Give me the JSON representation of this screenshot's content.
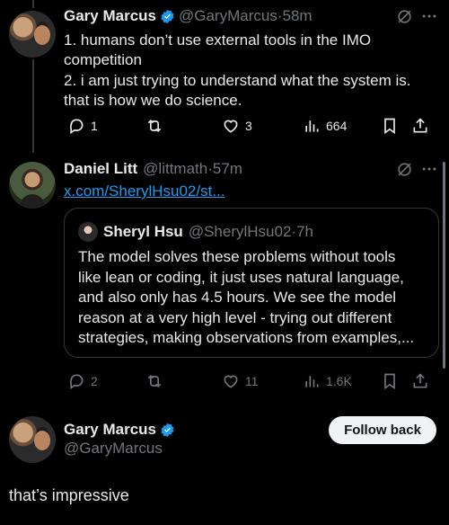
{
  "tweet1": {
    "name": "Gary Marcus",
    "handle": "@GaryMarcus",
    "time": "·58m",
    "line1": "1. humans don’t use external tools in the IMO",
    "line2": "competition",
    "line3": "2. i am just trying to understand what the system is.",
    "line4": "that is how we do science.",
    "replies": "1",
    "likes": "3",
    "views": "664"
  },
  "tweet2": {
    "name": "Daniel Litt",
    "handle": "@littmath",
    "time": "·57m",
    "link": "x.com/SherylHsu02/st...",
    "replies": "2",
    "likes": "11",
    "views": "1.6K"
  },
  "quote": {
    "name": "Sheryl Hsu",
    "handle": "@SherylHsu02",
    "time": "·7h",
    "line1": "The model solves these problems without tools",
    "line2": "like lean or coding, it just uses natural language,",
    "line3": "and also only has 4.5 hours. We see the model",
    "line4": "reason at a very high level - trying out different",
    "line5": "strategies, making observations from examples,..."
  },
  "profile": {
    "name": "Gary Marcus",
    "handle": "@GaryMarcus",
    "follow_label": "Follow back"
  },
  "reply_text": "that’s impressive",
  "icons": [
    "grok-icon",
    "more-icon",
    "reply-icon",
    "retweet-icon",
    "like-icon",
    "views-icon",
    "bookmark-icon",
    "share-icon",
    "verified-badge-icon"
  ],
  "colors": {
    "background": "#000000",
    "text": "#e7e9ea",
    "muted": "#71767b",
    "link": "#1d9bf0",
    "verified": "#1d9bf0"
  }
}
